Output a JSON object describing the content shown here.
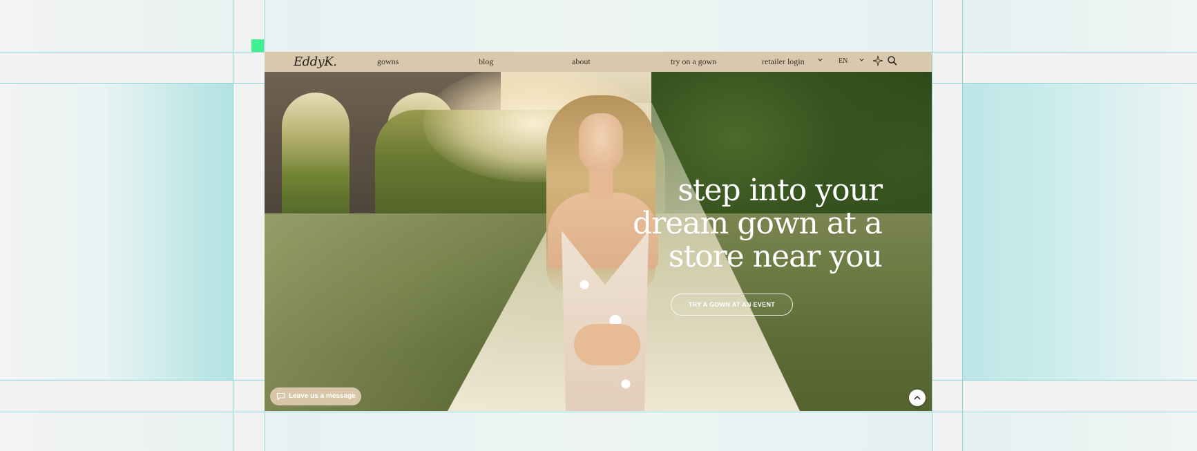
{
  "brand": {
    "logo_text": "EddyK."
  },
  "nav": {
    "items": [
      {
        "label": "gowns"
      },
      {
        "label": "blog"
      },
      {
        "label": "about"
      },
      {
        "label": "try on a gown"
      },
      {
        "label": "retailer login"
      }
    ],
    "language": "EN",
    "icons": [
      "chevron-down-icon",
      "sparkle-icon",
      "search-icon"
    ]
  },
  "hero": {
    "title_lines": [
      "step into your",
      "dream gown at a",
      "store near you"
    ],
    "cta_label": "TRY A GOWN AT AN EVENT"
  },
  "chat": {
    "label": "Leave us a message"
  },
  "colors": {
    "nav_bg": "#d8c8ad",
    "guide": "#8fd4d6",
    "marker": "#3ef08e",
    "chat_bg": "#d8c6a8"
  }
}
